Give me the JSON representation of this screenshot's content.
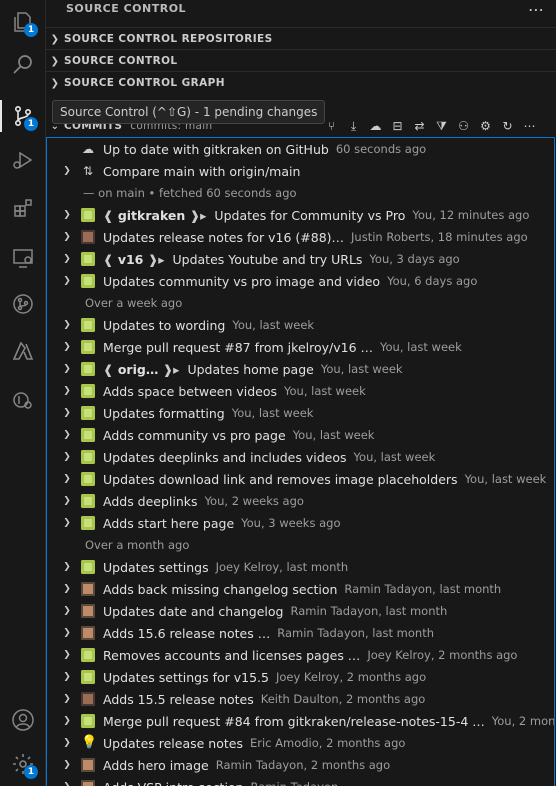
{
  "activity_bar": {
    "explorer_badge": "1",
    "scm_badge": "1",
    "settings_badge": "1"
  },
  "sidebar": {
    "title": "SOURCE CONTROL",
    "sections": [
      {
        "label": "SOURCE CONTROL REPOSITORIES"
      },
      {
        "label": "SOURCE CONTROL"
      },
      {
        "label": "SOURCE CONTROL GRAPH"
      }
    ]
  },
  "tooltip": "Source Control (^⇧G) - 1 pending changes",
  "commits_view": {
    "title": "COMMITS",
    "subtitle": "commits: main",
    "status": {
      "text": "Up to date with gitkraken on GitHub",
      "meta": "60 seconds ago"
    },
    "compare": {
      "text": "Compare main with origin/main"
    },
    "fetched": {
      "text": "— on main • fetched 60 seconds ago"
    },
    "groups": [
      {
        "label": "",
        "rows": [
          {
            "tag": "gitkraken",
            "msg": "Updates for Community vs Pro",
            "meta": "You, 12 minutes ago",
            "avatar": "green"
          },
          {
            "tag": "",
            "msg": "Updates release notes for v16 (#88)…",
            "meta": "Justin Roberts, 18 minutes ago",
            "avatar": "photo"
          },
          {
            "tag": "v16",
            "msg": "Updates Youtube and try URLs",
            "meta": "You, 3 days ago",
            "avatar": "green"
          },
          {
            "tag": "",
            "msg": "Updates community vs pro image and video",
            "meta": "You, 6 days ago",
            "avatar": "green"
          }
        ]
      },
      {
        "label": "Over a week ago",
        "rows": [
          {
            "tag": "",
            "msg": "Updates to wording",
            "meta": "You, last week",
            "avatar": "green"
          },
          {
            "tag": "",
            "msg": "Merge pull request #87 from jkelroy/v16 …",
            "meta": "You, last week",
            "avatar": "green"
          },
          {
            "tag": "orig…",
            "msg": "Updates home page",
            "meta": "You, last week",
            "avatar": "green"
          },
          {
            "tag": "",
            "msg": "Adds space between videos",
            "meta": "You, last week",
            "avatar": "green"
          },
          {
            "tag": "",
            "msg": "Updates formatting",
            "meta": "You, last week",
            "avatar": "green"
          },
          {
            "tag": "",
            "msg": "Adds community vs pro page",
            "meta": "You, last week",
            "avatar": "green"
          },
          {
            "tag": "",
            "msg": "Updates deeplinks and includes videos",
            "meta": "You, last week",
            "avatar": "green"
          },
          {
            "tag": "",
            "msg": "Updates download link and removes image placeholders",
            "meta": "You, last week",
            "avatar": "green"
          },
          {
            "tag": "",
            "msg": "Adds deeplinks",
            "meta": "You, 2 weeks ago",
            "avatar": "green"
          },
          {
            "tag": "",
            "msg": "Adds start here page",
            "meta": "You, 3 weeks ago",
            "avatar": "green"
          }
        ]
      },
      {
        "label": "Over a month ago",
        "rows": [
          {
            "tag": "",
            "msg": "Updates settings",
            "meta": "Joey Kelroy, last month",
            "avatar": "green"
          },
          {
            "tag": "",
            "msg": "Adds back missing changelog section",
            "meta": "Ramin Tadayon, last month",
            "avatar": "photo2"
          },
          {
            "tag": "",
            "msg": "Updates date and changelog",
            "meta": "Ramin Tadayon, last month",
            "avatar": "photo2"
          },
          {
            "tag": "",
            "msg": "Adds 15.6 release notes …",
            "meta": "Ramin Tadayon, last month",
            "avatar": "photo2"
          },
          {
            "tag": "",
            "msg": "Removes accounts and licenses pages …",
            "meta": "Joey Kelroy, 2 months ago",
            "avatar": "green"
          },
          {
            "tag": "",
            "msg": "Updates settings for v15.5",
            "meta": "Joey Kelroy, 2 months ago",
            "avatar": "green"
          },
          {
            "tag": "",
            "msg": "Adds 15.5 release notes",
            "meta": "Keith Daulton, 2 months ago",
            "avatar": "photo"
          },
          {
            "tag": "",
            "msg": "Merge pull request #84 from gitkraken/release-notes-15-4 …",
            "meta": "You, 2 mon",
            "avatar": "green"
          },
          {
            "tag": "",
            "msg": "Updates release notes",
            "meta": "Eric Amodio, 2 months ago",
            "avatar": "bulb"
          },
          {
            "tag": "",
            "msg": "Adds hero image",
            "meta": "Ramin Tadayon, 2 months ago",
            "avatar": "photo2"
          },
          {
            "tag": "",
            "msg": "Adds VSP intro section",
            "meta": "Ramin Tadayon",
            "avatar": "photo2"
          }
        ]
      }
    ]
  }
}
